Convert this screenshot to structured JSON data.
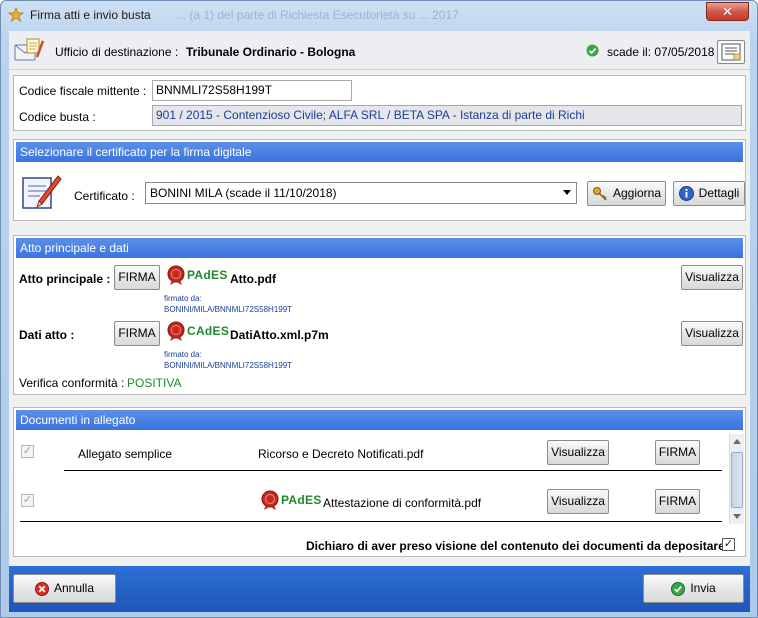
{
  "window": {
    "title": "Firma atti e invio busta",
    "title_ghost": "... (a 1) del parte di Richiesta Esecutorietà su ... 2017"
  },
  "header": {
    "ufficio_label": "Ufficio di destinazione :",
    "ufficio_value": "Tribunale Ordinario - Bologna",
    "scadenza": "scade il: 07/05/2018"
  },
  "mittente": {
    "codice_fiscale_label": "Codice fiscale mittente :",
    "codice_fiscale_value": "BNNMLI72S58H199T",
    "codice_busta_label": "Codice  busta :",
    "codice_busta_value": "901 / 2015 - Contenzioso Civile; ALFA SRL / BETA SPA - Istanza di parte di Richi"
  },
  "certificato": {
    "section_title": "Selezionare il certificato per la firma digitale",
    "label": "Certificato :",
    "selected": "BONINI MILA (scade il 11/10/2018)",
    "aggiorna_label": "Aggiorna",
    "dettagli_label": "Dettagli"
  },
  "atto": {
    "section_title": "Atto principale e dati",
    "principale_label": "Atto principale :",
    "principale_firma": "FIRMA",
    "principale_format": "PAdES",
    "principale_file": "Atto.pdf",
    "principale_signed_by_label": "firmato da:",
    "principale_signed_by": "BONINI/MILA/BNNMLI72S58H199T",
    "principale_visualizza": "Visualizza",
    "dati_label": "Dati atto :",
    "dati_firma": "FIRMA",
    "dati_format": "CAdES",
    "dati_file": "DatiAtto.xml.p7m",
    "dati_signed_by_label": "firmato da:",
    "dati_signed_by": "BONINI/MILA/BNNMLI72S58H199T",
    "dati_visualizza": "Visualizza",
    "verifica_label": "Verifica conformità :",
    "verifica_value": "POSITIVA"
  },
  "allegati": {
    "section_title": "Documenti in allegato",
    "rows": [
      {
        "tipo": "Allegato semplice",
        "format": "",
        "file": "Ricorso e Decreto Notificati.pdf",
        "visualizza": "Visualizza",
        "firma": "FIRMA"
      },
      {
        "tipo": "",
        "format": "PAdES",
        "file": "Attestazione di conformità.pdf",
        "visualizza": "Visualizza",
        "firma": "FIRMA"
      }
    ],
    "dichiaro": "Dichiaro di aver preso visione del contenuto dei documenti da depositare"
  },
  "footer": {
    "annulla_label": "Annulla",
    "invia_label": "Invia"
  },
  "colors": {
    "section_header": "#3b74e0",
    "footer": "#1e56b8",
    "green_format": "#1f8a2a",
    "readonly_blue": "#1a3e9a"
  }
}
